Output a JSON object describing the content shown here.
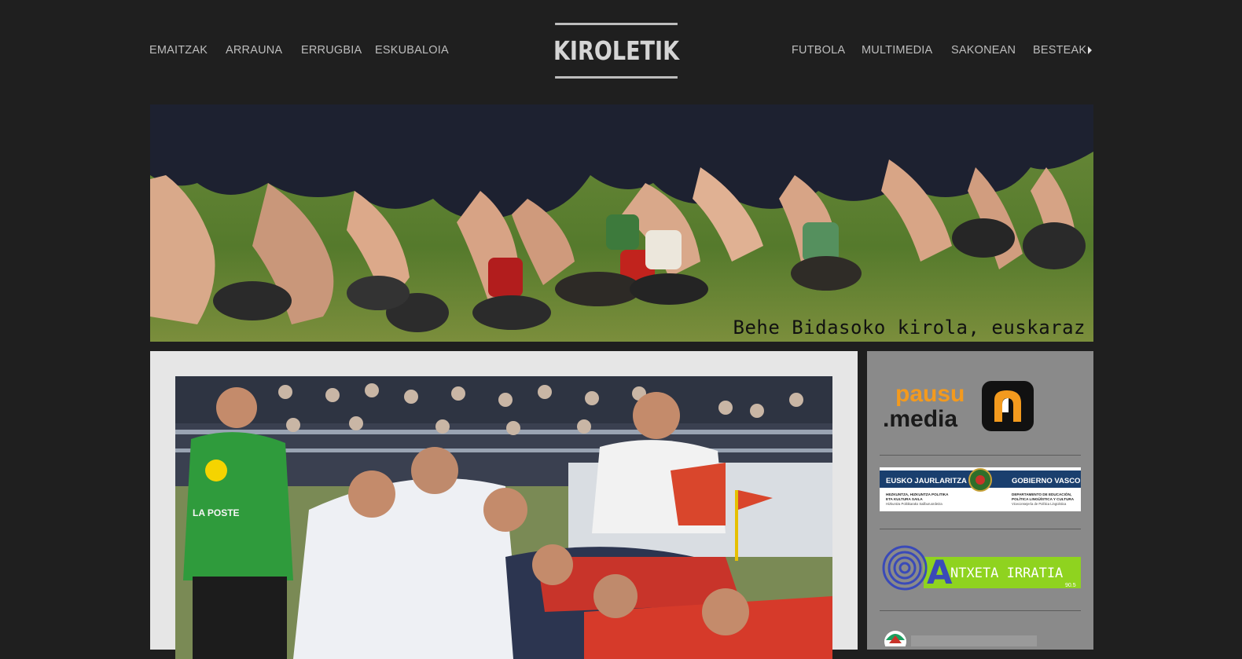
{
  "nav": {
    "left": [
      "EMAITZAK",
      "ARRAUNA",
      "ERRUGBIA",
      "ESKUBALOIA"
    ],
    "right": [
      "FUTBOLA",
      "MULTIMEDIA",
      "SAKONEAN",
      "BESTEAK"
    ]
  },
  "logo": {
    "text": "KIROLETIK"
  },
  "hero": {
    "caption": "Behe Bidasoko kirola, euskaraz"
  },
  "article_photo": {
    "referee_shirt_text": "LA POSTE"
  },
  "sidebar": {
    "pausu": {
      "line1": "pausu",
      "line2": ".media"
    },
    "eusko": {
      "left_title": "EUSKO JAURLARITZA",
      "right_title": "GOBIERNO VASCO",
      "left_line1": "HEZKUNTZA, HIZKUNTZA POLITIKA",
      "left_line2": "ETA KULTURA SAILA",
      "left_line3": "Hizkuntza Politikarako Sailburuordetza",
      "right_line1": "DEPARTAMENTO DE EDUCACIÓN,",
      "right_line2": "POLÍTICA LINGÜÍSTICA Y CULTURA",
      "right_line3": "Viceconsejería de Política Lingüística"
    },
    "antxeta": {
      "name": "NTXETA IRRATIA",
      "initial": "A",
      "freq": "90.5"
    }
  },
  "colors": {
    "background": "#1f1f1f",
    "nav_text": "#bdbdbd",
    "main_panel": "#e6e6e6",
    "sidebar": "#8a8a8a",
    "pausu_orange": "#f39a1e",
    "eusko_blue": "#1a3f6e",
    "antxeta_green": "#8fd31f"
  }
}
